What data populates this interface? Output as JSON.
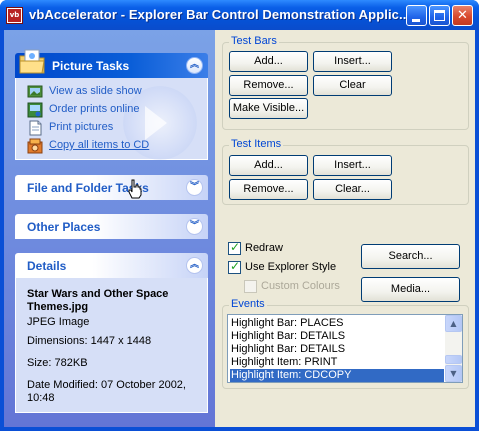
{
  "window": {
    "title": "vbAccelerator - Explorer Bar Control Demonstration Applic...",
    "app_icon_text": "vb",
    "controls": {
      "minimize": "minimize",
      "maximize": "maximize",
      "close": "✕"
    }
  },
  "explorer_bar": {
    "picture_tasks": {
      "title": "Picture Tasks",
      "chevron": "︽",
      "items": [
        {
          "label": "View as slide show",
          "icon": "slideshow-icon"
        },
        {
          "label": "Order prints online",
          "icon": "order-prints-icon"
        },
        {
          "label": "Print pictures",
          "icon": "print-icon"
        },
        {
          "label": "Copy all items to CD",
          "icon": "cd-copy-icon"
        }
      ]
    },
    "file_folder_tasks": {
      "title": "File and Folder Tasks",
      "chevron": "︾"
    },
    "other_places": {
      "title": "Other Places",
      "chevron": "︾"
    },
    "details": {
      "title": "Details",
      "chevron": "︽",
      "name": "Star Wars and Other Space Themes.jpg",
      "type": "JPEG Image",
      "dimensions": "Dimensions: 1447 x 1448",
      "size": "Size: 782KB",
      "date_modified": "Date Modified: 07 October 2002, 10:48"
    }
  },
  "test_bars": {
    "label": "Test Bars",
    "add": "Add...",
    "insert": "Insert...",
    "remove": "Remove...",
    "clear": "Clear",
    "make_visible": "Make Visible..."
  },
  "test_items": {
    "label": "Test Items",
    "add": "Add...",
    "insert": "Insert...",
    "remove": "Remove...",
    "clear": "Clear..."
  },
  "options": {
    "redraw": {
      "label": "Redraw",
      "checked": true
    },
    "explorer_style": {
      "label": "Use Explorer Style",
      "checked": true
    },
    "custom_colours": {
      "label": "Custom Colours",
      "checked": false,
      "enabled": false
    }
  },
  "actions": {
    "search": "Search...",
    "media": "Media..."
  },
  "events": {
    "label": "Events",
    "items": [
      "Highlight Bar: PLACES",
      "Highlight Bar: DETAILS",
      "Highlight Bar: DETAILS",
      "Highlight Item: PRINT",
      "Highlight Item: CDCOPY"
    ],
    "selected_index": 4
  },
  "colors": {
    "title_bar": "#0553d8",
    "explorer_bg": "#6f8ce0",
    "link": "#215dc6",
    "selection": "#316ac5",
    "frame_label": "#0046d5"
  }
}
